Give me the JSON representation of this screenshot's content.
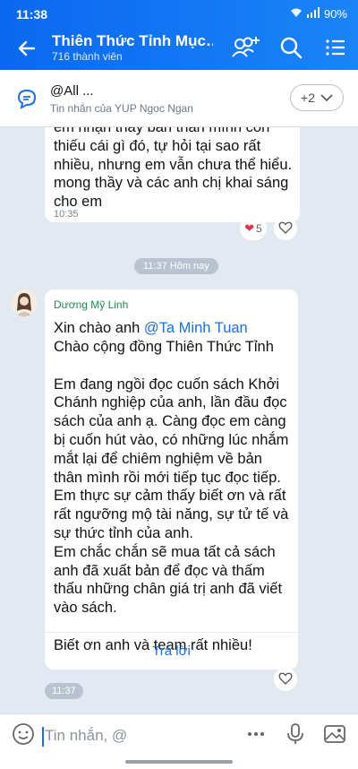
{
  "status": {
    "time": "11:38",
    "battery": "90%"
  },
  "header": {
    "title": "Thiên Thức Tỉnh Mục…",
    "subtitle": "716 thành viên"
  },
  "pinned": {
    "title": "@All ...",
    "subtitle": "Tin nhắn của YUP Ngoc Ngan",
    "more_count": "+2"
  },
  "messages": {
    "first": {
      "text": "em nhận thấy bản thân mình còn\nthiếu cái gì đó, tự hỏi tại sao rất\nnhiều, nhưng em vẫn chưa thể hiểu.\nmong thầy và các anh chị khai sáng\ncho em",
      "time": "10:35",
      "reaction_count": "5"
    },
    "divider": "11:37 Hôm nay",
    "second": {
      "sender": "Dương Mỹ Linh",
      "greeting": "Xin chào anh ",
      "mention": "@Ta Minh Tuan",
      "body": "Chào cộng đồng Thiên Thức Tỉnh\n\nEm đang ngồi đọc cuốn sách Khởi\nChánh nghiệp của anh, lần đầu đọc\nsách của anh ạ. Càng đọc em càng\nbị cuốn hút vào, có những lúc nhắm\nmắt lại để chiêm nghiệm về bản\nthân mình rồi mới tiếp tục đọc tiếp.\nEm thực sự cảm thấy biết ơn và rất\nrất ngưỡng mộ tài năng, sự tử tế và\nsự thức tỉnh của anh.\nEm chắc chắn sẽ mua tất cả sách\nanh đã xuất bản để đọc và thấm\nthấu những chân giá trị anh đã viết\nvào sách.\n\nBiết ơn anh và team rất nhiều!",
      "reply_label": "Trả lời",
      "time": "11:37"
    }
  },
  "composer": {
    "placeholder": "Tin nhắn, @"
  }
}
